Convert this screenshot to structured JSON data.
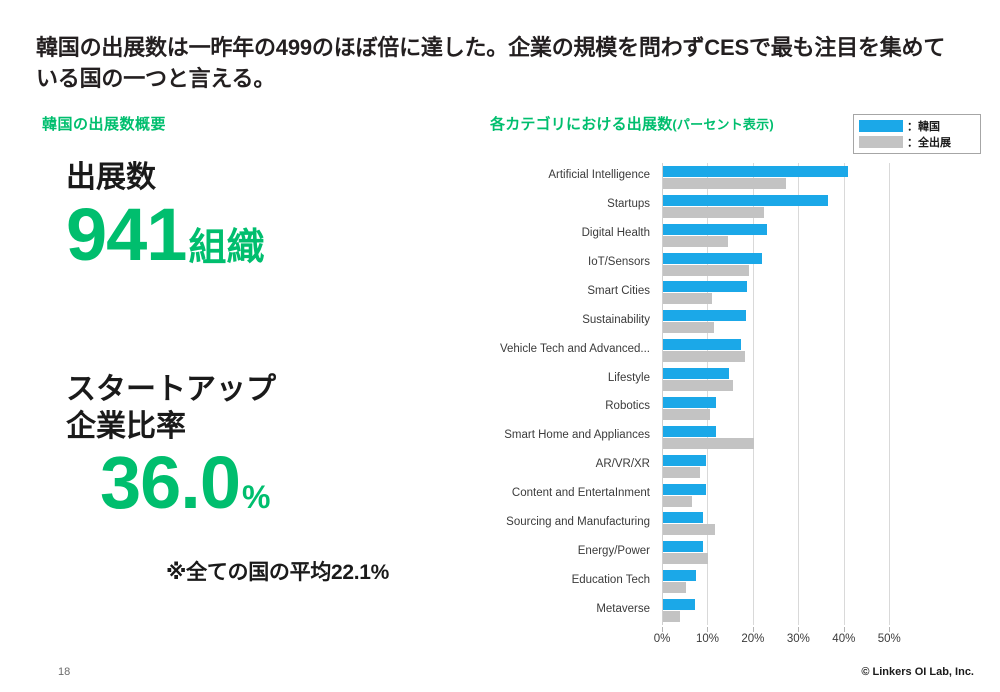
{
  "slide": {
    "headline": "韓国の出展数は一昨年の499のほぼ倍に達した。企業の規模を問わずCESで最も注目を集めている国の一つと言える。",
    "page_number": "18",
    "copyright": "© Linkers OI Lab, Inc."
  },
  "colors": {
    "accent_green": "#00BE6E",
    "korea_blue": "#1BA8E8",
    "all_gray": "#C3C3C3",
    "text_dark": "#231f20"
  },
  "left_panel": {
    "subtitle": "韓国の出展数概要",
    "stat_exhibitors": {
      "label": "出展数",
      "value": "941",
      "unit": "組織"
    },
    "stat_startup_ratio": {
      "label_line1": "スタートアップ",
      "label_line2": "企業比率",
      "value": "36.0",
      "unit": "%",
      "note": "※全ての国の平均22.1%"
    }
  },
  "chart_panel": {
    "title_main": "各カテゴリにおける出展数",
    "title_paren": "(パーセント表示)",
    "legend": [
      {
        "swatch": "#1BA8E8",
        "label": "：韓国"
      },
      {
        "swatch": "#C3C3C3",
        "label": "：全出展"
      }
    ]
  },
  "chart_data": {
    "type": "bar",
    "orientation": "horizontal",
    "title": "各カテゴリにおける出展数(パーセント表示)",
    "xlabel": "",
    "ylabel": "",
    "xlim": [
      0,
      55
    ],
    "xticks": [
      0,
      10,
      20,
      30,
      40,
      50
    ],
    "xtick_labels": [
      "0%",
      "10%",
      "20%",
      "30%",
      "40%",
      "50%"
    ],
    "grid": true,
    "legend_position": "top-right",
    "categories": [
      "Artificial Intelligence",
      "Startups",
      "Digital Health",
      "IoT/Sensors",
      "Smart Cities",
      "Sustainability",
      "Vehicle Tech and Advanced...",
      "Lifestyle",
      "Robotics",
      "Smart Home and Appliances",
      "AR/VR/XR",
      "Content and EntertaInment",
      "Sourcing and Manufacturing",
      "Energy/Power",
      "Education Tech",
      "Metaverse"
    ],
    "series": [
      {
        "name": "韓国",
        "color": "#1BA8E8",
        "values": [
          40.6,
          36.3,
          22.9,
          21.8,
          18.4,
          18.2,
          17.1,
          14.5,
          11.6,
          11.6,
          9.4,
          9.4,
          8.8,
          8.8,
          7.3,
          7.1
        ]
      },
      {
        "name": "全出展",
        "color": "#C3C3C3",
        "values": [
          27.1,
          22.2,
          14.3,
          19.0,
          10.8,
          11.2,
          18.0,
          15.3,
          10.4,
          20.0,
          8.1,
          6.3,
          11.4,
          9.8,
          5.1,
          3.7
        ]
      }
    ]
  }
}
